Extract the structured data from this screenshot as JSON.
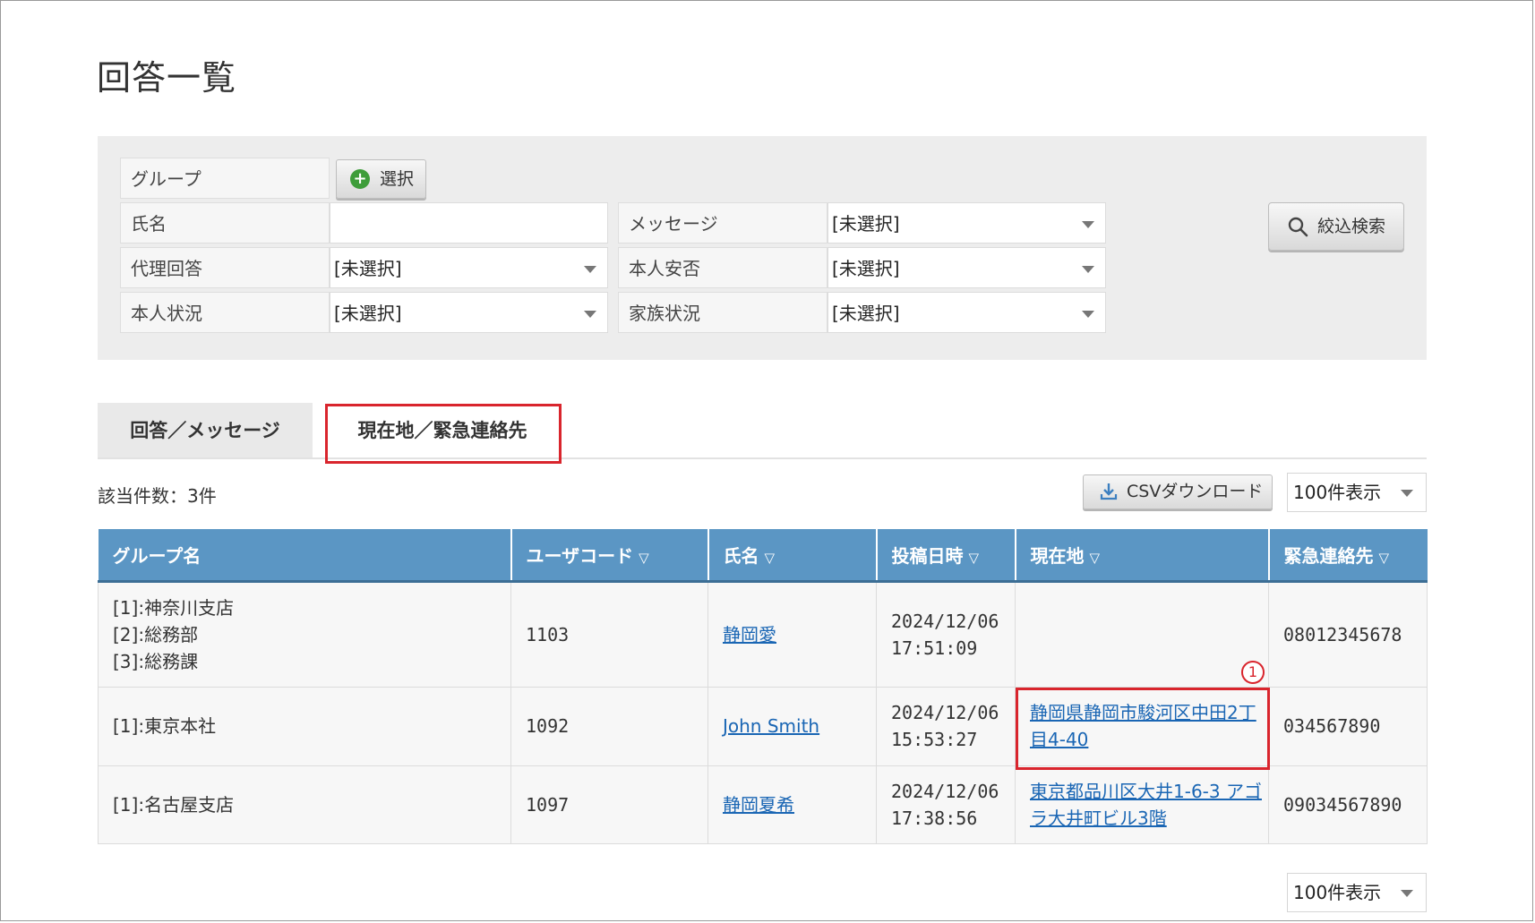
{
  "page": {
    "title": "回答一覧"
  },
  "filters": {
    "group": {
      "label": "グループ",
      "button": "選択"
    },
    "name": {
      "label": "氏名",
      "value": ""
    },
    "message": {
      "label": "メッセージ",
      "value": "[未選択]"
    },
    "proxy_answer": {
      "label": "代理回答",
      "value": "[未選択]"
    },
    "self_safety": {
      "label": "本人安否",
      "value": "[未選択]"
    },
    "self_status": {
      "label": "本人状況",
      "value": "[未選択]"
    },
    "family_status": {
      "label": "家族状況",
      "value": "[未選択]"
    },
    "search_button": "絞込検索"
  },
  "tabs": [
    {
      "label": "回答／メッセージ",
      "active": false
    },
    {
      "label": "現在地／緊急連絡先",
      "active": true
    }
  ],
  "results": {
    "count_label": "該当件数：3件",
    "csv_button": "CSVダウンロード",
    "per_page": "100件表示",
    "per_page_bottom": "100件表示"
  },
  "table": {
    "columns": [
      {
        "label": "グループ名",
        "sortable": false
      },
      {
        "label": "ユーザコード",
        "sortable": true
      },
      {
        "label": "氏名",
        "sortable": true
      },
      {
        "label": "投稿日時",
        "sortable": true
      },
      {
        "label": "現在地",
        "sortable": true
      },
      {
        "label": "緊急連絡先",
        "sortable": true
      }
    ],
    "sort_glyph": "▽",
    "rows": [
      {
        "groups": [
          "[1]:神奈川支店",
          "[2]:総務部",
          "[3]:総務課"
        ],
        "user_code": "1103",
        "name": "静岡愛",
        "date": "2024/12/06",
        "time": "17:51:09",
        "location": "",
        "contact": "08012345678"
      },
      {
        "groups": [
          "[1]:東京本社"
        ],
        "user_code": "1092",
        "name": "John Smith",
        "date": "2024/12/06",
        "time": "15:53:27",
        "location": "静岡県静岡市駿河区中田2丁目4-40",
        "contact": "034567890"
      },
      {
        "groups": [
          "[1]:名古屋支店"
        ],
        "user_code": "1097",
        "name": "静岡夏希",
        "date": "2024/12/06",
        "time": "17:38:56",
        "location": "東京都品川区大井1-6-3 アゴラ大井町ビル3階",
        "contact": "09034567890"
      }
    ]
  },
  "annotation": {
    "badge": "1",
    "color": "#d9252d"
  },
  "colors": {
    "header": "#5b96c4",
    "link": "#1a66b4",
    "panel": "#ededed"
  }
}
